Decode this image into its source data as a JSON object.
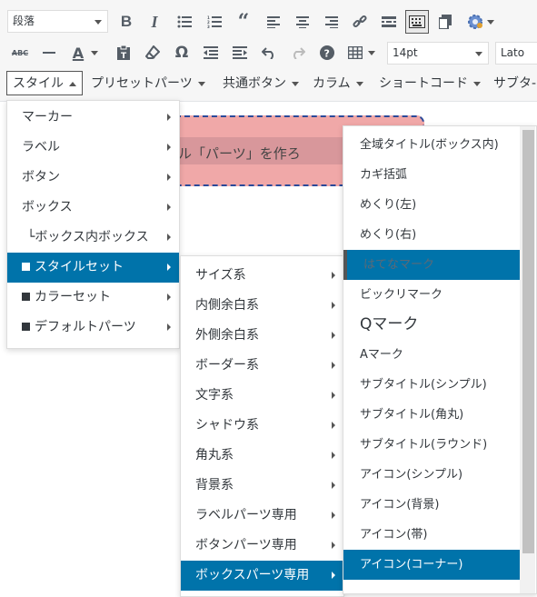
{
  "toolbar": {
    "format_select": "段落",
    "font_size": "14pt",
    "font_family": "Lato",
    "row1_icons": [
      "bold-icon",
      "italic-icon",
      "bulleted-list-icon",
      "numbered-list-icon",
      "blockquote-icon",
      "align-left-icon",
      "align-center-icon",
      "align-right-icon",
      "link-icon",
      "read-more-icon",
      "toolbar-toggle-icon",
      "paste-icon",
      "settings-gear-icon"
    ],
    "row2_icons": [
      "strikethrough-icon",
      "horizontal-line-icon",
      "text-color-icon",
      "paste-text-icon",
      "clear-formatting-icon",
      "special-character-icon",
      "outdent-icon",
      "indent-icon",
      "undo-icon",
      "redo-icon",
      "help-icon",
      "table-icon"
    ]
  },
  "menubar": {
    "items": [
      {
        "label": "スタイル"
      },
      {
        "label": "プリセットパーツ"
      },
      {
        "label": "共通ボタン"
      },
      {
        "label": "カラム"
      },
      {
        "label": "ショートコード"
      },
      {
        "label": "サブタ-"
      }
    ]
  },
  "content": {
    "box_text": "ル「パーツ」を作ろ"
  },
  "menu1": {
    "items": [
      {
        "label": "マーカー",
        "square": false
      },
      {
        "label": "ラベル",
        "square": false
      },
      {
        "label": "ボタン",
        "square": false
      },
      {
        "label": "ボックス",
        "square": false
      },
      {
        "label": "└ボックス内ボックス",
        "square": false
      },
      {
        "label": "スタイルセット",
        "square": true
      },
      {
        "label": "カラーセット",
        "square": true
      },
      {
        "label": "デフォルトパーツ",
        "square": true
      }
    ]
  },
  "menu2": {
    "items": [
      {
        "label": "サイズ系"
      },
      {
        "label": "内側余白系"
      },
      {
        "label": "外側余白系"
      },
      {
        "label": "ボーダー系"
      },
      {
        "label": "文字系"
      },
      {
        "label": "シャドウ系"
      },
      {
        "label": "角丸系"
      },
      {
        "label": "背景系"
      },
      {
        "label": "ラベルパーツ専用"
      },
      {
        "label": "ボタンパーツ専用"
      },
      {
        "label": "ボックスパーツ専用"
      }
    ]
  },
  "menu3": {
    "items": [
      {
        "label": "全域タイトル(ボックス内)"
      },
      {
        "label": "カギ括弧"
      },
      {
        "label": "めくり(左)"
      },
      {
        "label": "めくり(右)"
      },
      {
        "label": "はてなマーク"
      },
      {
        "label": "ビックリマーク"
      },
      {
        "label": "Qマーク"
      },
      {
        "label": "Aマーク"
      },
      {
        "label": "サブタイトル(シンプル)"
      },
      {
        "label": "サブタイトル(角丸)"
      },
      {
        "label": "サブタイトル(ラウンド)"
      },
      {
        "label": "アイコン(シンプル)"
      },
      {
        "label": "アイコン(背景)"
      },
      {
        "label": "アイコン(帯)"
      },
      {
        "label": "アイコン(コーナー)"
      }
    ]
  },
  "colors": {
    "accent": "#0073aa",
    "box_fill": "#f0a8a8",
    "box_border": "#2a4a9a"
  }
}
